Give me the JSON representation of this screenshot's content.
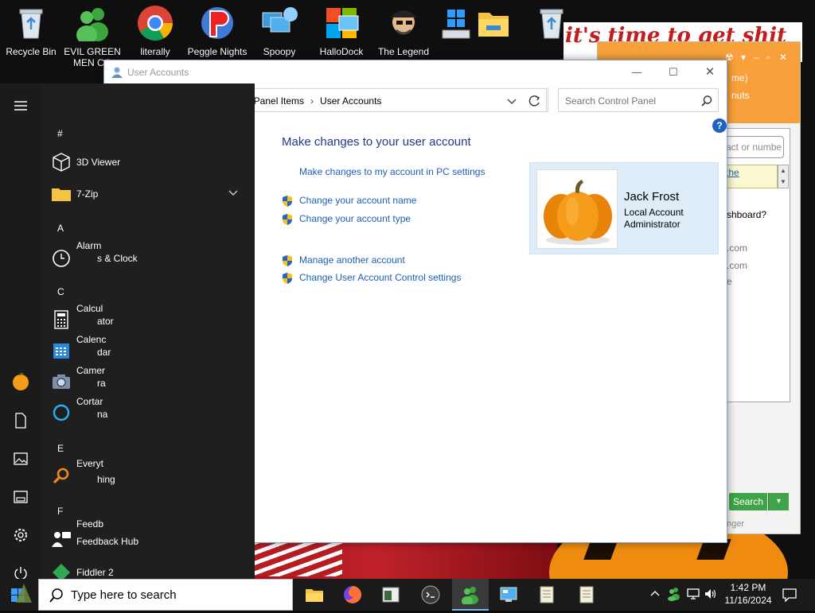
{
  "desktop": {
    "banner_text": "it's time to get shit",
    "icons": [
      {
        "label": "Recycle Bin",
        "icon": "recycle-bin-icon"
      },
      {
        "label": "EVIL GREEN MEN CO",
        "icon": "green-men-icon"
      },
      {
        "label": "literally",
        "icon": "chrome-icon"
      },
      {
        "label": "Peggle Nights",
        "icon": "peggle-icon"
      },
      {
        "label": "Spoopy",
        "icon": "network-computers-icon"
      },
      {
        "label": "HalloDock",
        "icon": "hallodock-icon"
      },
      {
        "label": "The Legend",
        "icon": "pirate-icon"
      }
    ]
  },
  "im_window": {
    "title_fragment": "me)",
    "status_fragment": "nuts",
    "search_placeholder_fragment": "act or numbe",
    "link_fragment": "the",
    "question_fragment": "shboard?",
    "contact1": ".com",
    "contact2": ".com",
    "contact3": "e",
    "search_button": "Search",
    "footer_fragment": "nger"
  },
  "window": {
    "title": "User Accounts",
    "breadcrumb": [
      "rol Panel Items",
      "User Accounts"
    ],
    "search_placeholder": "Search Control Panel",
    "help": "?",
    "heading": "Make changes to your user account",
    "tasks": [
      {
        "label": "Make changes to my account in PC settings",
        "shield": false
      },
      {
        "label": "Change your account name",
        "shield": true
      },
      {
        "label": "Change your account type",
        "shield": true
      },
      {
        "label": "Manage another account",
        "shield": true
      },
      {
        "label": "Change User Account Control settings",
        "shield": true
      }
    ],
    "account": {
      "name": "Jack Frost",
      "type": "Local Account",
      "role": "Administrator"
    }
  },
  "start_menu": {
    "letters": {
      "hash": "#",
      "a": "A",
      "c": "C",
      "e": "E",
      "f": "F"
    },
    "apps": {
      "viewer": "3D Viewer",
      "zip": "7-Zip",
      "alarm_a": "Alarm",
      "alarm_b": "s & Clock",
      "calc_a": "Calcul",
      "calc_b": "ator",
      "calendar_a": "Calenc",
      "calendar_b": "dar",
      "camera_a": "Camer",
      "camera_b": "ra",
      "cortana_a": "Cortar",
      "cortana_b": "na",
      "everything_a": "Everyt",
      "everything_b": "hing",
      "feedback_a": "Feedb",
      "feedback_b": "Feedback Hub",
      "fiddler": "Fiddler 2"
    }
  },
  "taskbar": {
    "search_placeholder": "Type here to search",
    "time": "1:42 PM",
    "date": "11/16/2024"
  },
  "colors": {
    "link": "#1c5fb8",
    "heading": "#1e3a8a",
    "account_bg": "#deedf8",
    "im_orange": "#f8a13a",
    "start_bg": "#1f1f1f"
  }
}
